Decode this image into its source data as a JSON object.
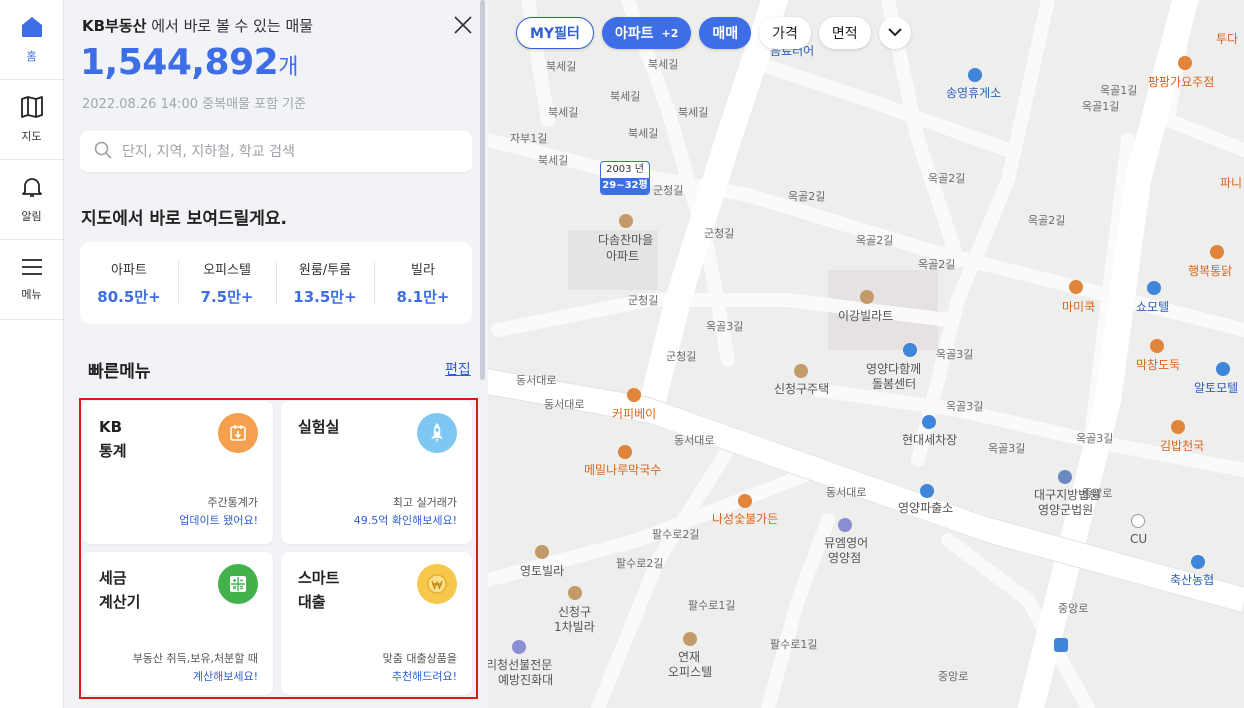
{
  "nav": {
    "items": [
      {
        "label": "홈"
      },
      {
        "label": "지도"
      },
      {
        "label": "알림"
      },
      {
        "label": "메뉴"
      }
    ]
  },
  "panel": {
    "brand": "KB부동산",
    "headline_rest": " 에서 바로 볼 수 있는 매물",
    "listing_count": "1,544,892",
    "count_unit": "개",
    "as_of": "2022.08.26 14:00 중복매물 포함 기준",
    "search_placeholder": "단지, 지역, 지하철, 학교 검색",
    "map_section_title": "지도에서 바로 보여드릴게요.",
    "stats": [
      {
        "label": "아파트",
        "value": "80.5만+"
      },
      {
        "label": "오피스텔",
        "value": "7.5만+"
      },
      {
        "label": "원룸/투룸",
        "value": "13.5만+"
      },
      {
        "label": "빌라",
        "value": "8.1만+"
      }
    ],
    "quick_menu_title": "빠른메뉴",
    "edit_label": "편집",
    "quick_menu": [
      {
        "title_line1": "KB",
        "title_line2": "통계",
        "desc1": "주간통계가",
        "desc2": "업데이트 됐어요!",
        "icon_color": "#f5a04f",
        "icon": "calendar-download-icon"
      },
      {
        "title_line1": "실험실",
        "title_line2": "",
        "desc1": "최고 실거래가",
        "desc2": "49.5억 확인해보세요!",
        "icon_color": "#7ec7f2",
        "icon": "rocket-icon"
      },
      {
        "title_line1": "세금",
        "title_line2": "계산기",
        "desc1": "부동산 취득,보유,처분할 때",
        "desc2": "계산해보세요!",
        "icon_color": "#43b24a",
        "icon": "calculator-icon"
      },
      {
        "title_line1": "스마트",
        "title_line2": "대출",
        "desc1": "맞춤 대출상품을",
        "desc2": "추천해드려요!",
        "icon_color": "#f6c74a",
        "icon": "won-coin-icon"
      }
    ]
  },
  "filters": {
    "my_filter": "MY필터",
    "property_type": "아파트",
    "property_extra": "+2",
    "deal_type": "매매",
    "price": "가격",
    "area": "면적"
  },
  "map": {
    "marker": {
      "year": "2003 년",
      "size": "29~32평"
    },
    "road_labels": [
      "북세길",
      "북세길",
      "북세길",
      "북세길",
      "북세길",
      "북세길",
      "북세길",
      "자부1길",
      "군청길",
      "군청길",
      "군청길",
      "군청길",
      "옥골1길",
      "옥골1길",
      "옥골2길",
      "옥골2길",
      "옥골2길",
      "옥골2길",
      "옥골2길",
      "옥골3길",
      "옥골3길",
      "옥골3길",
      "옥골3길",
      "옥골3길",
      "동서대로",
      "동서대로",
      "동서대로",
      "동서대로",
      "팔수로2길",
      "팔수로2길",
      "팔수로1길",
      "팔수로1길",
      "중앙로",
      "중앙로",
      "중앙로"
    ],
    "poi_labels": [
      "다솜찬마을",
      "아파트",
      "이강빌라트",
      "신청구주택",
      "영양다함께",
      "돌봄센터",
      "커피베이",
      "현대세차장",
      "메밀나루막국수",
      "나성숯불가든",
      "영양파출소",
      "대구지방법원",
      "영양군법원",
      "뮤엠영어",
      "영양점",
      "영토빌라",
      "신청구",
      "1차빌라",
      "연재",
      "오피스텔",
      "리청선불전문",
      "예방진화대",
      "송영휴게소",
      "팡팡가요주점",
      "투다",
      "파니",
      "행복통닭",
      "마미쿡",
      "쇼모텔",
      "막창도둑",
      "알토모텔",
      "김밥천국",
      "CU",
      "축산농협",
      "음료터어"
    ]
  }
}
